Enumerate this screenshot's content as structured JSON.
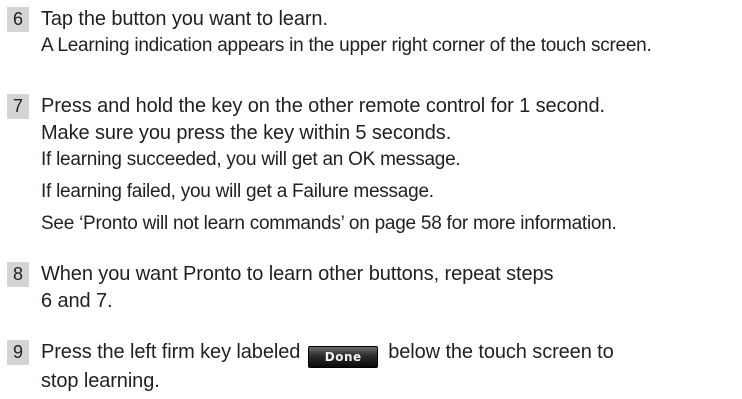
{
  "steps": [
    {
      "number": "6",
      "instruction_lines": [
        "Tap the button you want to learn."
      ],
      "notes": [
        "A Learning indication appears in the upper right corner of the touch screen."
      ]
    },
    {
      "number": "7",
      "instruction_lines": [
        "Press and hold the key on the other remote control for 1 second.",
        "Make sure you press the key within 5 seconds."
      ],
      "notes": [
        "If learning succeeded, you will get an OK message.",
        "If learning failed, you will get a Failure message.",
        "See ‘Pronto will not learn commands’ on page 58 for more information."
      ]
    },
    {
      "number": "8",
      "instruction_lines": [
        "When you want Pronto to learn other buttons, repeat steps",
        "6 and 7."
      ],
      "notes": []
    },
    {
      "number": "9",
      "instruction_before": "Press the left firm key labeled",
      "button_label": "Done",
      "instruction_after": "below the touch screen to",
      "instruction_line2": "stop learning."
    }
  ]
}
